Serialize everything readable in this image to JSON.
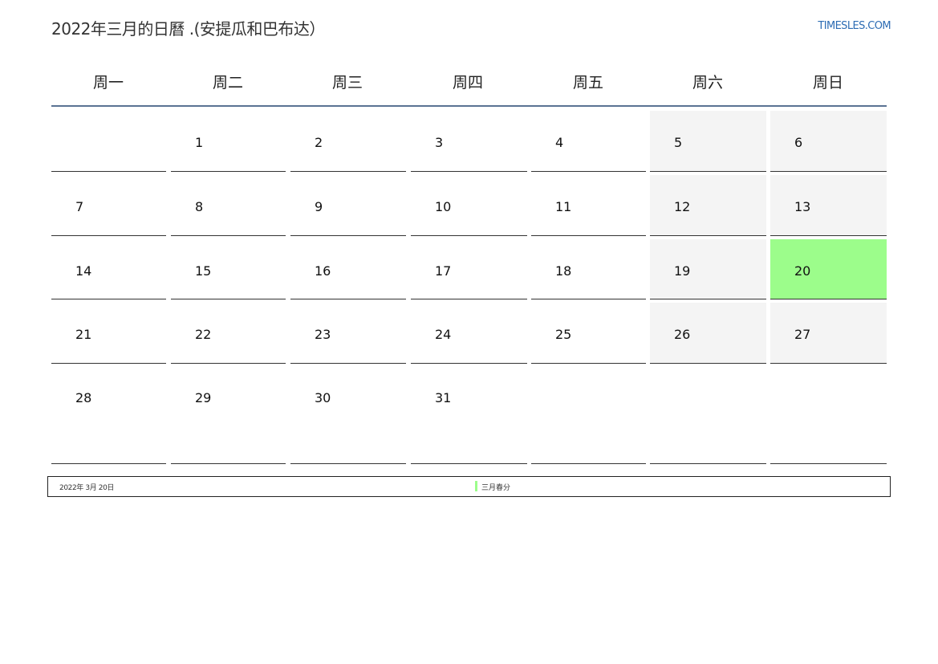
{
  "header": {
    "title": "2022年三月的日曆 .(安提瓜和巴布达）",
    "site": "TIMESLES.COM"
  },
  "colors": {
    "header_rule": "#5b7393",
    "weekend_bg": "#f4f4f4",
    "holiday_bg": "#9cfd8b",
    "link": "#2e6db4"
  },
  "weekdays": [
    "周一",
    "周二",
    "周三",
    "周四",
    "周五",
    "周六",
    "周日"
  ],
  "weeks": [
    [
      "",
      "1",
      "2",
      "3",
      "4",
      "5",
      "6"
    ],
    [
      "7",
      "8",
      "9",
      "10",
      "11",
      "12",
      "13"
    ],
    [
      "14",
      "15",
      "16",
      "17",
      "18",
      "19",
      "20"
    ],
    [
      "21",
      "22",
      "23",
      "24",
      "25",
      "26",
      "27"
    ],
    [
      "28",
      "29",
      "30",
      "31",
      "",
      "",
      ""
    ]
  ],
  "highlighted_day": "20",
  "legend": {
    "date": "2022年 3月 20日",
    "event": "三月春分"
  }
}
